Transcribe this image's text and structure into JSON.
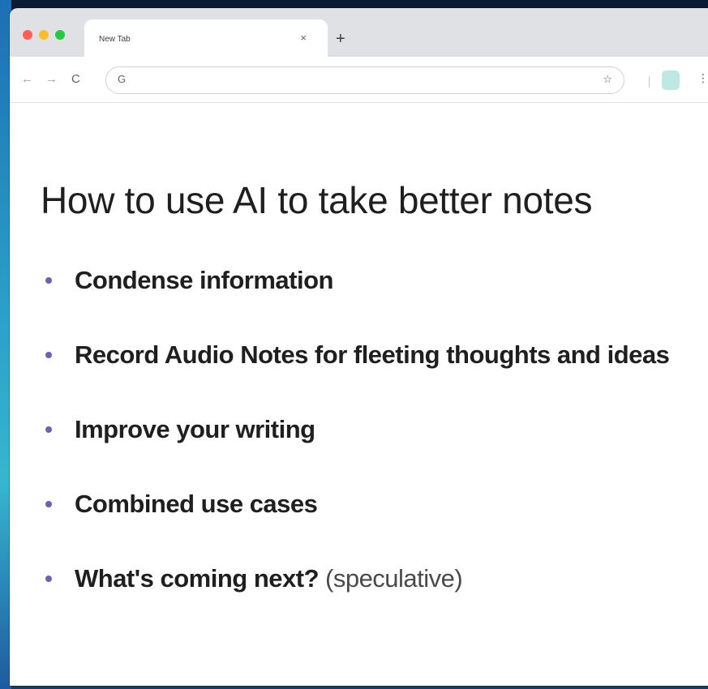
{
  "browser": {
    "traffic_lights": {
      "close_color": "#ff5f57",
      "minimize_color": "#febc2e",
      "maximize_color": "#28c840"
    },
    "tab": {
      "title": "New Tab",
      "close_glyph": "×"
    },
    "new_tab_glyph": "+",
    "toolbar": {
      "back_glyph": "←",
      "forward_glyph": "→",
      "reload_glyph": "C",
      "omnibox_icon": "G",
      "omnibox_value": "",
      "bookmark_glyph": "☆",
      "menu_glyph": "⋮"
    }
  },
  "slide": {
    "title": "How to use AI to take better notes",
    "bullet_color": "#6a63b5",
    "items": [
      {
        "text": "Condense information",
        "note": ""
      },
      {
        "text": "Record Audio Notes for fleeting thoughts and ideas",
        "note": ""
      },
      {
        "text": "Improve your writing",
        "note": ""
      },
      {
        "text": "Combined use cases",
        "note": ""
      },
      {
        "text": "What's coming next?",
        "note": "(speculative)"
      }
    ]
  }
}
